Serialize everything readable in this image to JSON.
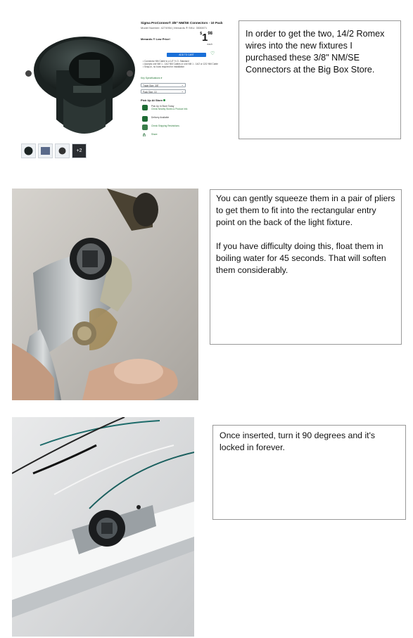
{
  "product": {
    "title": "Sigma ProConnex® 3/8\" NM/SE Connectors - 10 Pack",
    "model": "Model Number: 4274954 | Menards ® SKU: 3530871",
    "brand": "Menards ® Low Price!",
    "price_currency": "$",
    "price_dollars": "1",
    "price_cents": "98",
    "price_unit": "each",
    "add_to_cart": "ADD TO CART",
    "bullets": [
      "Connector NM Cable to a 1/2\" K.O. Standard",
      "Accepts one NM 1 - 14/2 NM Cables or one NM 1 - 14/2 or 12/2 NM Cable",
      "Snap-in, no tools required for installation"
    ],
    "key_spec_link": "Key Specifications ▾",
    "select_1": "Trade Size: 3/8\"",
    "select_2": "Pack Size: 10",
    "pickup_title": "Pick Up At Store",
    "options": [
      {
        "title": "Pick Up In Store Today",
        "sub": "Check Nearby Stores & Product Info"
      },
      {
        "title": "Delivery Available",
        "sub": ""
      },
      {
        "title": "Check Shipping Restrictions",
        "sub": ""
      },
      {
        "title": "Share",
        "sub": ""
      }
    ],
    "thumb_more": "+2"
  },
  "notes": {
    "box1": "In order to get the two, 14/2 Romex wires into the new fixtures I purchased these 3/8\" NM/SE Connectors at the Big Box Store.",
    "box2_p1": "You can gently squeeze them in a pair of pliers to get them to fit into the rectangular entry point on the back of the light fixture.",
    "box2_p2": "If you have difficulty doing this, float them in boiling water for 45 seconds.  That will soften them considerably.",
    "box3": "Once inserted, turn it 90 degrees and it's locked in forever."
  },
  "colors": {
    "accent_green": "#1e8e3e",
    "cart_blue": "#1a6fd8",
    "border_gray": "#999999"
  }
}
